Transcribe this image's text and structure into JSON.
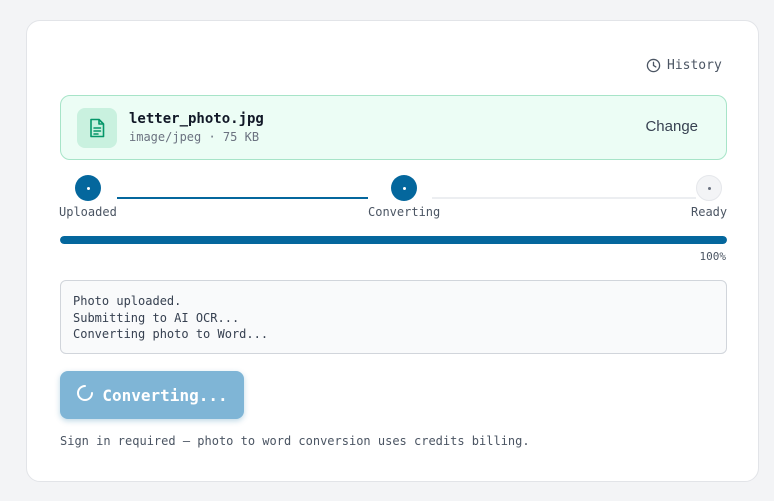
{
  "header": {
    "history_label": "History",
    "history_icon": "clock-icon"
  },
  "file": {
    "icon": "document-icon",
    "name": "letter_photo.jpg",
    "meta": "image/jpeg · 75 KB",
    "change_label": "Change"
  },
  "steps": [
    {
      "label": "Uploaded",
      "state": "done"
    },
    {
      "label": "Converting",
      "state": "active"
    },
    {
      "label": "Ready",
      "state": "pending"
    }
  ],
  "progress": {
    "value": 1.0,
    "label": "100%"
  },
  "log": [
    "Photo uploaded.",
    "Submitting to AI OCR...",
    "Converting photo to Word..."
  ],
  "convert_button": {
    "label": "Converting...",
    "icon": "spinner-icon",
    "disabled": true
  },
  "note": "Sign in required — photo to word conversion uses credits billing.",
  "colors": {
    "accent": "#04679d",
    "file_bg": "#ecfdf5",
    "file_border": "#a7e4c8",
    "button_disabled": "#7fb5d6"
  }
}
